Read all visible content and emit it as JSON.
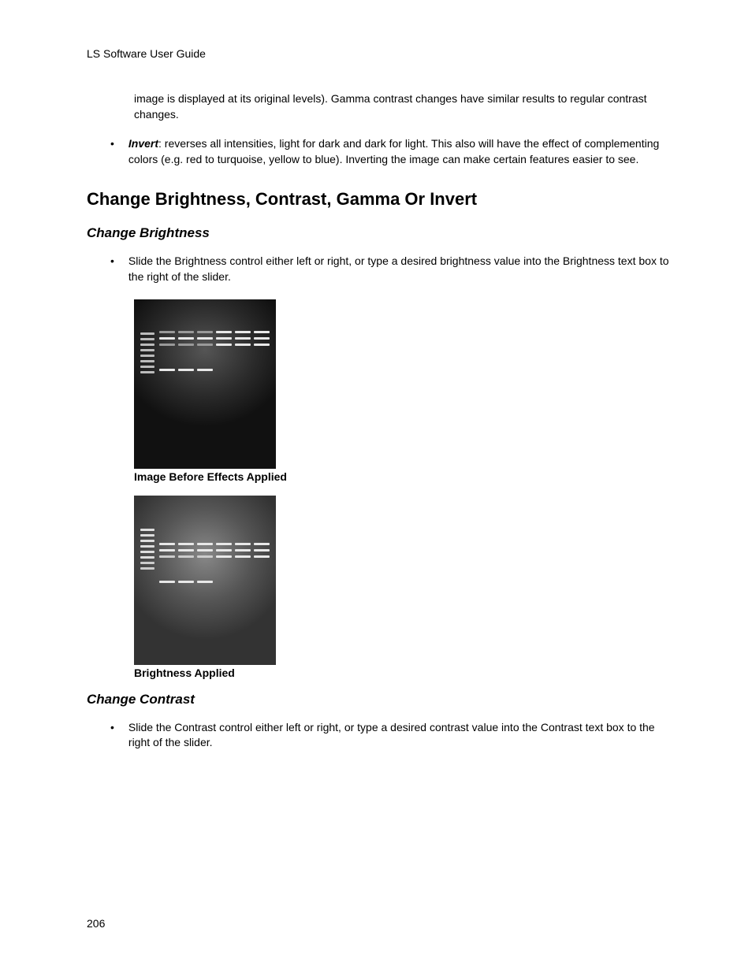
{
  "header": {
    "title": "LS Software User Guide"
  },
  "intro": {
    "continuation": "image is displayed at its original levels). Gamma contrast changes have similar results to regular contrast changes.",
    "invert_lead": "Invert",
    "invert_body": ": reverses all intensities, light for dark and dark for light. This also will have the effect of complementing colors (e.g. red to turquoise, yellow to blue). Inverting the image can make certain features easier to see."
  },
  "section": {
    "heading": "Change Brightness, Contrast, Gamma Or Invert"
  },
  "brightness": {
    "heading": "Change Brightness",
    "instruction": "Slide the Brightness control either left or right, or type a desired brightness value into the Brightness text box to the right of the slider.",
    "caption_before": "Image Before Effects Applied",
    "caption_after": "Brightness Applied"
  },
  "contrast": {
    "heading": "Change Contrast",
    "instruction": "Slide the Contrast control either left or right, or type a desired contrast value into the Contrast text box to the right of the slider."
  },
  "page_number": "206",
  "bullet_glyph": "•"
}
